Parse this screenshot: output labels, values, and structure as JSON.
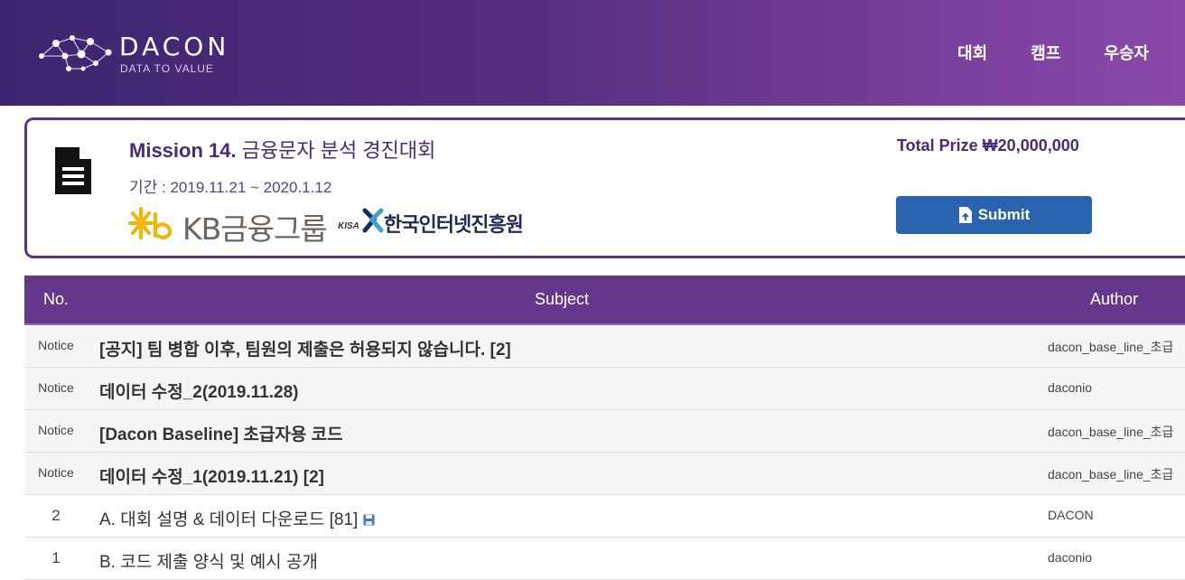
{
  "header": {
    "brand": "DACON",
    "tagline": "DATA TO VALUE",
    "nav": [
      "대회",
      "캠프",
      "우승자"
    ]
  },
  "mission": {
    "title_bold": "Mission 14.",
    "title_rest": " 금융문자 분석 경진대회",
    "period": "기간 : 2019.11.21 ~ 2020.1.12",
    "prize": "Total Prize ₩20,000,000",
    "submit_label": "Submit",
    "sponsors": {
      "kb": "KB금융그룹",
      "kisa_abbr": "KISA",
      "kisa": "한국인터넷진흥원"
    }
  },
  "table": {
    "headers": {
      "no": "No.",
      "subject": "Subject",
      "author": "Author"
    },
    "rows": [
      {
        "no": "Notice",
        "subject": "[공지] 팀 병합 이후, 팀원의 제출은 허용되지 않습니다. [2]",
        "author": "dacon_base_line_초급"
      },
      {
        "no": "Notice",
        "subject": "데이터 수정_2(2019.11.28)",
        "author": "daconio"
      },
      {
        "no": "Notice",
        "subject": "[Dacon Baseline] 초급자용 코드",
        "author": "dacon_base_line_초급"
      },
      {
        "no": "Notice",
        "subject": "데이터 수정_1(2019.11.21) [2]",
        "author": "dacon_base_line_초급"
      },
      {
        "no": "2",
        "subject": "A. 대회 설명 & 데이터 다운로드 [81]",
        "author": "DACON",
        "attachment_icon": "save-icon"
      },
      {
        "no": "1",
        "subject": "B. 코드 제출 양식 및 예시 공개",
        "author": "daconio"
      }
    ]
  },
  "colors": {
    "header_start": "#3e2470",
    "header_end": "#8a49a9",
    "accent_purple": "#65378b",
    "submit_blue": "#2a63b0"
  }
}
